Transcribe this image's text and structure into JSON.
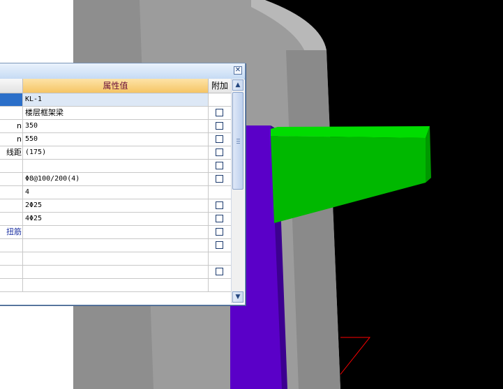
{
  "viewport": {
    "colors": {
      "background": "#000000",
      "wall": "#a0a0a0",
      "column": "#5a00c8",
      "beam": "#00c000",
      "axis": "#ff0000"
    }
  },
  "property_panel": {
    "close_glyph": "✕",
    "headers": {
      "name": "",
      "value": "属性值",
      "attach": "附加"
    },
    "rows": [
      {
        "name": "",
        "value": "KL-1",
        "checkbox": false,
        "selected": true
      },
      {
        "name": "",
        "value": "楼层框架梁",
        "checkbox": true
      },
      {
        "name": "n",
        "value": "350",
        "checkbox": true
      },
      {
        "name": "n",
        "value": "550",
        "checkbox": true
      },
      {
        "name": "线距",
        "value": "(175)",
        "checkbox": true
      },
      {
        "name": "",
        "value": "",
        "checkbox": true
      },
      {
        "name": "",
        "value": "Φ8@100/200(4)",
        "checkbox": true
      },
      {
        "name": "",
        "value": "4",
        "checkbox": false
      },
      {
        "name": "",
        "value": "2Φ25",
        "checkbox": true
      },
      {
        "name": "",
        "value": "4Φ25",
        "checkbox": true
      },
      {
        "name": "扭筋",
        "value": "",
        "checkbox": true,
        "link": true
      },
      {
        "name": "",
        "value": "",
        "checkbox": true
      },
      {
        "name": "",
        "value": "",
        "checkbox": false
      },
      {
        "name": "",
        "value": "",
        "checkbox": true
      },
      {
        "name": "",
        "value": "",
        "checkbox": false
      }
    ],
    "scroll_up_glyph": "▲",
    "scroll_down_glyph": "▼"
  }
}
